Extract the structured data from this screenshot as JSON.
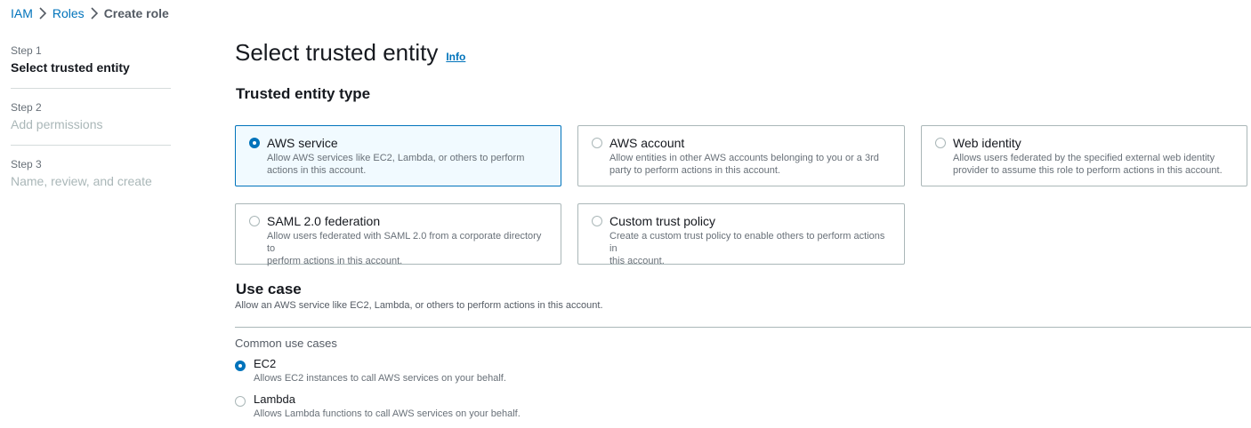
{
  "breadcrumb": {
    "items": [
      "IAM",
      "Roles"
    ],
    "current": "Create role"
  },
  "steps": [
    {
      "num": "Step 1",
      "label": "Select trusted entity"
    },
    {
      "num": "Step 2",
      "label": "Add permissions"
    },
    {
      "num": "Step 3",
      "label": "Name, review, and create"
    }
  ],
  "header": {
    "title": "Select trusted entity",
    "info": "Info"
  },
  "trusted_entity": {
    "heading": "Trusted entity type",
    "options": [
      {
        "title": "AWS service",
        "desc_lines": [
          "Allow AWS services like EC2, Lambda, or others to perform",
          "actions in this account."
        ]
      },
      {
        "title": "AWS account",
        "desc_lines": [
          "Allow entities in other AWS accounts belonging to you or a 3rd",
          "party to perform actions in this account."
        ]
      },
      {
        "title": "Web identity",
        "desc_lines": [
          "Allows users federated by the specified external web identity",
          "provider to assume this role to perform actions in this account."
        ]
      },
      {
        "title": "SAML 2.0 federation",
        "desc_lines": [
          "Allow users federated with SAML 2.0 from a corporate directory to",
          "perform actions in this account."
        ]
      },
      {
        "title": "Custom trust policy",
        "desc_lines": [
          "Create a custom trust policy to enable others to perform actions in",
          "this account."
        ]
      }
    ]
  },
  "use_case": {
    "heading": "Use case",
    "desc": "Allow an AWS service like EC2, Lambda, or others to perform actions in this account.",
    "common_label": "Common use cases",
    "options": [
      {
        "title": "EC2",
        "desc": "Allows EC2 instances to call AWS services on your behalf."
      },
      {
        "title": "Lambda",
        "desc": "Allows Lambda functions to call AWS services on your behalf."
      }
    ]
  },
  "colors": {
    "accent": "#0073bb",
    "selected_bg": "#f1faff",
    "border": "#aab7b8"
  },
  "icons": {
    "breadcrumb_separator": "chevron-right-icon",
    "radio": "radio-icon"
  }
}
